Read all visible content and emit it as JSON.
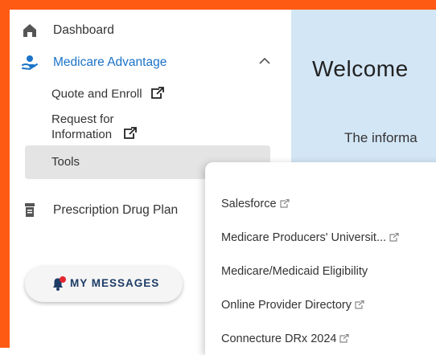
{
  "sidebar": {
    "dashboard_label": "Dashboard",
    "medicare_advantage_label": "Medicare Advantage",
    "sub_items": {
      "quote_and_enroll": "Quote and Enroll",
      "request_line1": "Request for",
      "request_line2": "Information",
      "tools": "Tools"
    },
    "prescription_label": "Prescription Drug Plan",
    "messages_button_label": "MY MESSAGES"
  },
  "main": {
    "welcome_text": "Welcome",
    "info_text": "The informa"
  },
  "tools_dropdown": {
    "items": [
      "Salesforce",
      "Medicare Producers' Universit...",
      "Medicare/Medicaid Eligibility",
      "Online Provider Directory",
      "Connecture DRx 2024"
    ]
  },
  "colors": {
    "frame": "#ff5a14",
    "accent": "#1a73c8",
    "main_bg": "#d3e6f6",
    "messages_text": "#1d3c66",
    "notification_dot": "#e3262f"
  }
}
